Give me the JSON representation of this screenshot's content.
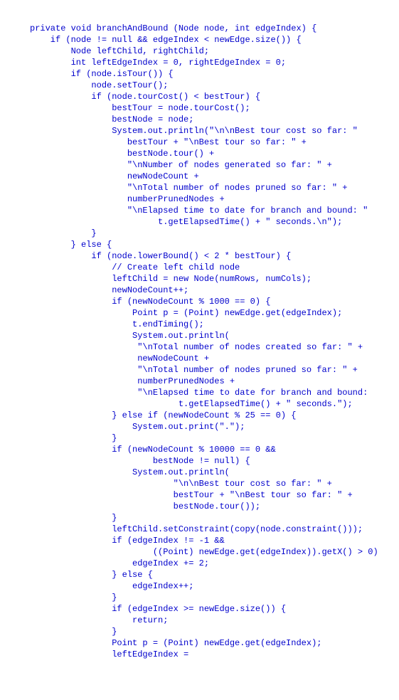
{
  "code_lines": [
    "private void branchAndBound (Node node, int edgeIndex) {",
    "    if (node != null && edgeIndex < newEdge.size()) {",
    "        Node leftChild, rightChild;",
    "        int leftEdgeIndex = 0, rightEdgeIndex = 0;",
    "        if (node.isTour()) {",
    "            node.setTour();",
    "            if (node.tourCost() < bestTour) {",
    "                bestTour = node.tourCost();",
    "                bestNode = node;",
    "                System.out.println(\"\\n\\nBest tour cost so far: \"",
    "                   bestTour + \"\\nBest tour so far: \" +",
    "                   bestNode.tour() +",
    "                   \"\\nNumber of nodes generated so far: \" +",
    "                   newNodeCount +",
    "                   \"\\nTotal number of nodes pruned so far: \" +",
    "                   numberPrunedNodes +",
    "                   \"\\nElapsed time to date for branch and bound: \"",
    "                         t.getElapsedTime() + \" seconds.\\n\");",
    "            }",
    "        } else {",
    "            if (node.lowerBound() < 2 * bestTour) {",
    "                // Create left child node",
    "                leftChild = new Node(numRows, numCols);",
    "                newNodeCount++;",
    "                if (newNodeCount % 1000 == 0) {",
    "                    Point p = (Point) newEdge.get(edgeIndex);",
    "                    t.endTiming();",
    "                    System.out.println(",
    "                     \"\\nTotal number of nodes created so far: \" +",
    "                     newNodeCount +",
    "                     \"\\nTotal number of nodes pruned so far: \" +",
    "                     numberPrunedNodes +",
    "                     \"\\nElapsed time to date for branch and bound:",
    "                             t.getElapsedTime() + \" seconds.\");",
    "                } else if (newNodeCount % 25 == 0) {",
    "                    System.out.print(\".\");",
    "                }",
    "                if (newNodeCount % 10000 == 0 &&",
    "                        bestNode != null) {",
    "                    System.out.println(",
    "                            \"\\n\\nBest tour cost so far: \" +",
    "                            bestTour + \"\\nBest tour so far: \" +",
    "                            bestNode.tour());",
    "                }",
    "                leftChild.setConstraint(copy(node.constraint()));",
    "                if (edgeIndex != -1 &&",
    "                        ((Point) newEdge.get(edgeIndex)).getX() > 0)",
    "                    edgeIndex += 2;",
    "                } else {",
    "                    edgeIndex++;",
    "                }",
    "                if (edgeIndex >= newEdge.size()) {",
    "                    return;",
    "                }",
    "                Point p = (Point) newEdge.get(edgeIndex);",
    "                leftEdgeIndex ="
  ]
}
